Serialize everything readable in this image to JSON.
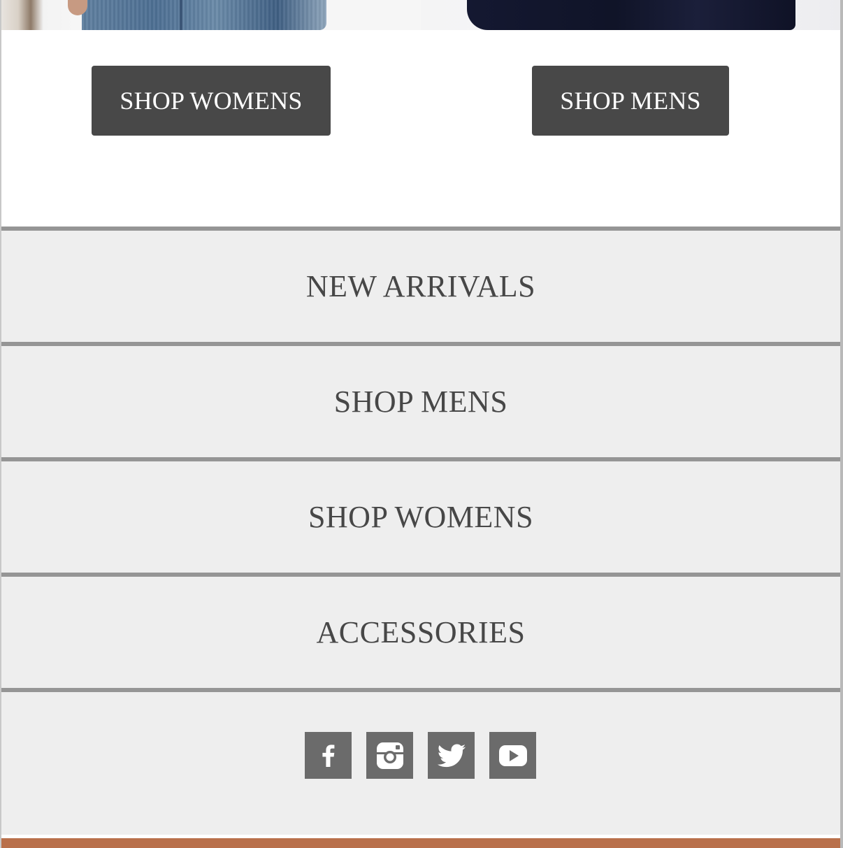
{
  "hero_buttons": {
    "womens_label": "SHOP WOMENS",
    "mens_label": "SHOP MENS",
    "button_color": "#484848"
  },
  "menu": {
    "items": [
      {
        "label": "NEW ARRIVALS"
      },
      {
        "label": "SHOP MENS"
      },
      {
        "label": "SHOP WOMENS"
      },
      {
        "label": "ACCESSORIES"
      }
    ],
    "background": "#eeeeee",
    "divider_color": "#959595",
    "text_color": "#474747"
  },
  "social": {
    "icons": [
      "facebook-icon",
      "instagram-icon",
      "twitter-icon",
      "youtube-icon"
    ],
    "icon_color": "#6b6b6b"
  },
  "footer": {
    "accent_color": "#b9704b"
  }
}
